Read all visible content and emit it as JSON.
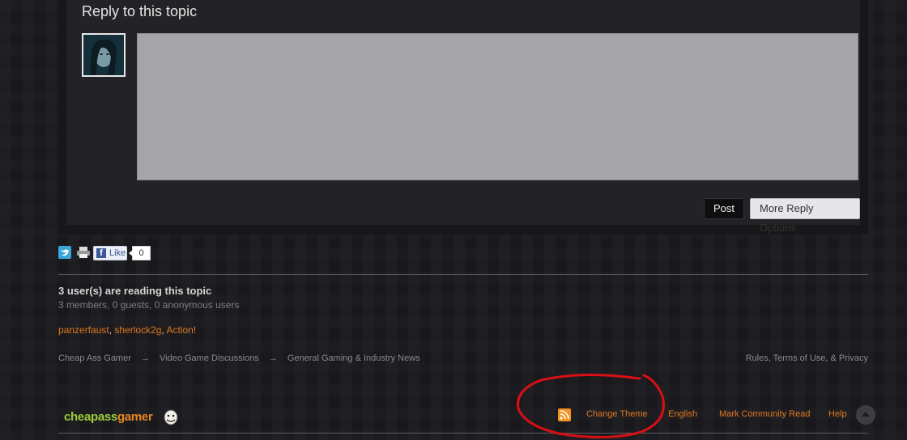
{
  "reply": {
    "title": "Reply to this topic",
    "post_label": "Post",
    "more_options_label": "More Reply Options"
  },
  "share": {
    "like_label": "Like",
    "like_count": "0"
  },
  "readers": {
    "title": "3 user(s) are reading this topic",
    "subtitle": "3 members, 0 guests, 0 anonymous users",
    "users": [
      "panzerfaust",
      "sherlock2g",
      "Action!"
    ]
  },
  "breadcrumb": {
    "items": [
      "Cheap Ass Gamer",
      "Video Game Discussions",
      "General Gaming & Industry News"
    ],
    "separator": "→"
  },
  "rules_link": "Rules, Terms of Use, & Privacy",
  "brand": {
    "part1": "cheapass",
    "part2": "gamer"
  },
  "footer_links": {
    "change_theme": "Change Theme",
    "language": "English",
    "mark_read": "Mark Community Read",
    "help": "Help"
  },
  "icons": {
    "twitter": "twitter-icon",
    "print": "print-icon",
    "facebook": "facebook-icon",
    "rss": "rss-icon",
    "back_to_top": "arrow-up-icon"
  },
  "colors": {
    "accent": "#e0781e",
    "annotation": "#d80f15"
  }
}
